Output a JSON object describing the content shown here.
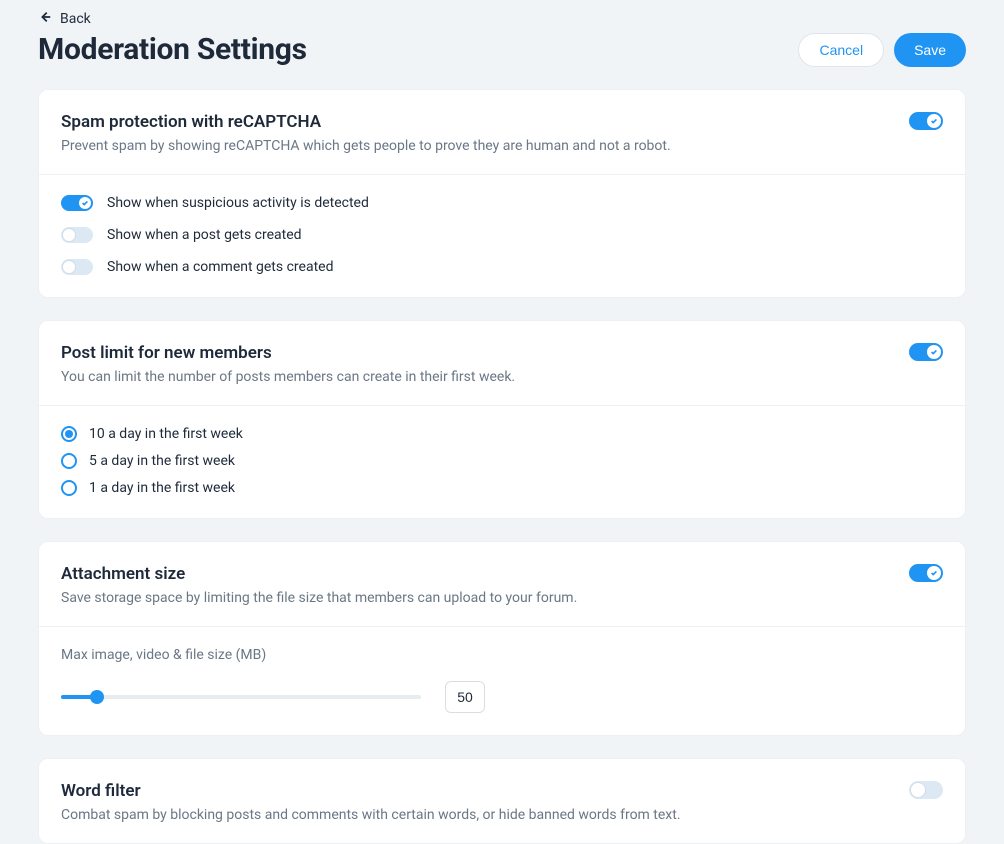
{
  "nav": {
    "back_label": "Back"
  },
  "header": {
    "title": "Moderation Settings",
    "cancel_label": "Cancel",
    "save_label": "Save"
  },
  "spam": {
    "title": "Spam protection with reCAPTCHA",
    "desc": "Prevent spam by showing reCAPTCHA which gets people to prove they are human and not a robot.",
    "enabled": true,
    "options": [
      {
        "label": "Show when suspicious activity is detected",
        "on": true
      },
      {
        "label": "Show when a post gets created",
        "on": false
      },
      {
        "label": "Show when a comment gets created",
        "on": false
      }
    ]
  },
  "post_limit": {
    "title": "Post limit for new members",
    "desc": "You can limit the number of posts members can create in their first week.",
    "enabled": true,
    "options": [
      {
        "label": "10 a day in the first week",
        "selected": true
      },
      {
        "label": "5 a day in the first week",
        "selected": false
      },
      {
        "label": "1 a day in the first week",
        "selected": false
      }
    ]
  },
  "attachment": {
    "title": "Attachment size",
    "desc": "Save storage space by limiting the file size that members can upload to your forum.",
    "enabled": true,
    "slider_label": "Max image, video & file size (MB)",
    "value": "50"
  },
  "word_filter": {
    "title": "Word filter",
    "desc": "Combat spam by blocking posts and comments with certain words, or hide banned words from text.",
    "enabled": false
  }
}
